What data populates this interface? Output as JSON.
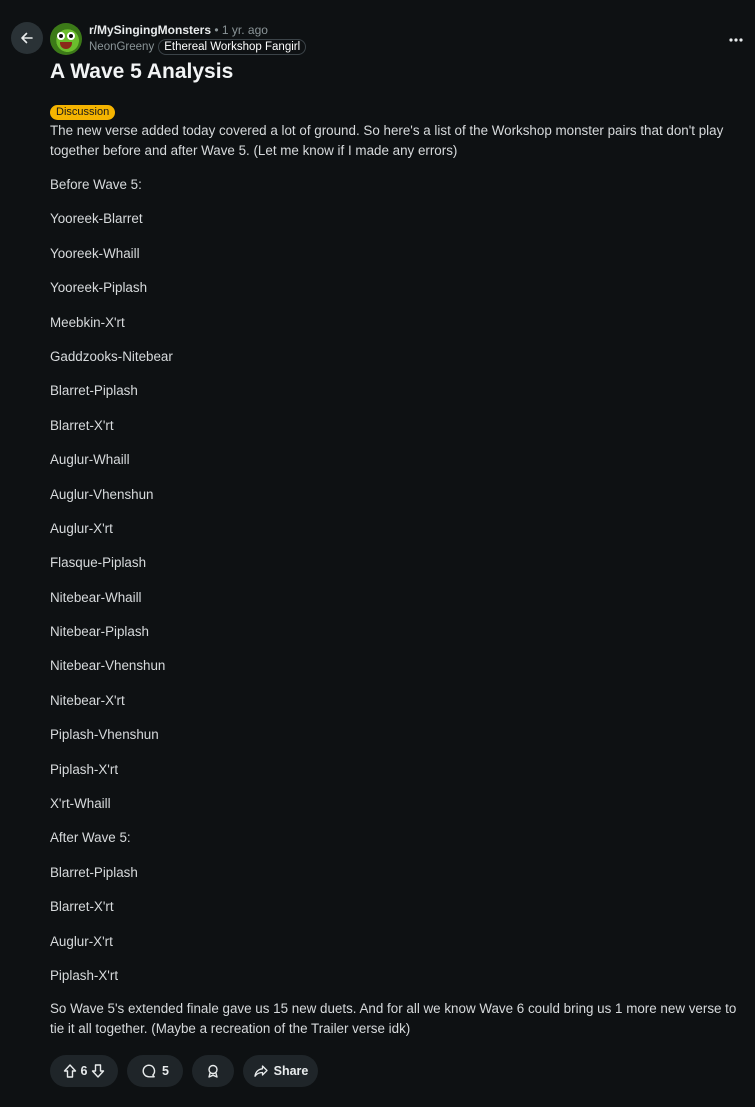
{
  "header": {
    "subreddit": "r/MySingingMonsters",
    "separator": "•",
    "time_ago": "1 yr. ago",
    "username": "NeonGreeny",
    "user_flair": "Ethereal Workshop Fangirl"
  },
  "post": {
    "title": "A Wave 5 Analysis",
    "tag": "Discussion",
    "intro": "The new verse added today covered a lot of ground. So here's a list of the Workshop monster pairs that don't play together before and after Wave 5. (Let me know if I made any errors)",
    "lines": [
      "Before Wave 5:",
      "Yooreek-Blarret",
      "Yooreek-Whaill",
      "Yooreek-Piplash",
      "Meebkin-X'rt",
      "Gaddzooks-Nitebear",
      "Blarret-Piplash",
      "Blarret-X'rt",
      "Auglur-Whaill",
      "Auglur-Vhenshun",
      "Auglur-X'rt",
      "Flasque-Piplash",
      "Nitebear-Whaill",
      "Nitebear-Piplash",
      "Nitebear-Vhenshun",
      "Nitebear-X'rt",
      "Piplash-Vhenshun",
      "Piplash-X'rt",
      "X'rt-Whaill",
      "After Wave 5:",
      "Blarret-Piplash",
      "Blarret-X'rt",
      "Auglur-X'rt",
      "Piplash-X'rt"
    ],
    "outro": "So Wave 5's extended finale gave us 15 new duets. And for all we know Wave 6 could bring us 1 more new verse to tie it all together. (Maybe a recreation of the Trailer verse idk)"
  },
  "actions": {
    "vote_count": "6",
    "comment_count": "5",
    "share_label": "Share"
  },
  "icons": {
    "back": "arrow-left-icon",
    "more": "more-horizontal-icon",
    "upvote": "arrow-up-icon",
    "downvote": "arrow-down-icon",
    "comment": "comment-bubble-icon",
    "award": "award-icon",
    "share": "share-arrow-icon"
  },
  "colors": {
    "background": "#0e1113",
    "tag": "#f5b400",
    "pill": "#1f2529"
  }
}
